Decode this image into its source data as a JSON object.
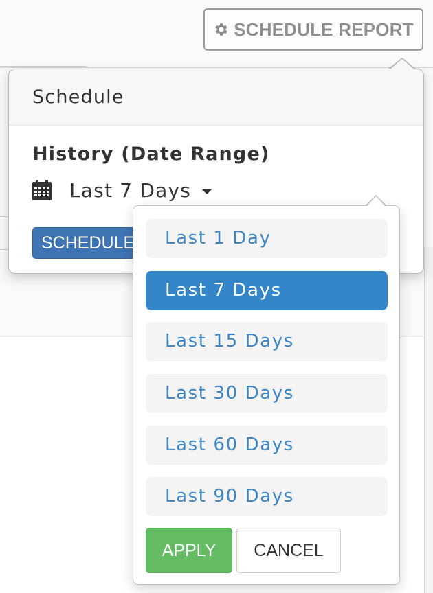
{
  "toolbar": {
    "schedule_report_label": "SCHEDULE REPORT",
    "schedule_report_icon": "gear-icon"
  },
  "popover": {
    "title": "Schedule",
    "history_label": "History (Date Range)",
    "range_icon": "calendar-icon",
    "selected_range": "Last 7 Days",
    "schedule_button_label": "SCHEDULE"
  },
  "dropdown": {
    "options": [
      {
        "label": "Last 1 Day",
        "selected": false
      },
      {
        "label": "Last 7 Days",
        "selected": true
      },
      {
        "label": "Last 15 Days",
        "selected": false
      },
      {
        "label": "Last 30 Days",
        "selected": false
      },
      {
        "label": "Last 60 Days",
        "selected": false
      },
      {
        "label": "Last 90 Days",
        "selected": false
      }
    ],
    "apply_label": "APPLY",
    "cancel_label": "CANCEL"
  },
  "colors": {
    "selected_option_bg": "#3585c9",
    "option_text": "#3a86c8",
    "apply_bg": "#64bb63",
    "schedule_bg": "#3f74b5"
  }
}
